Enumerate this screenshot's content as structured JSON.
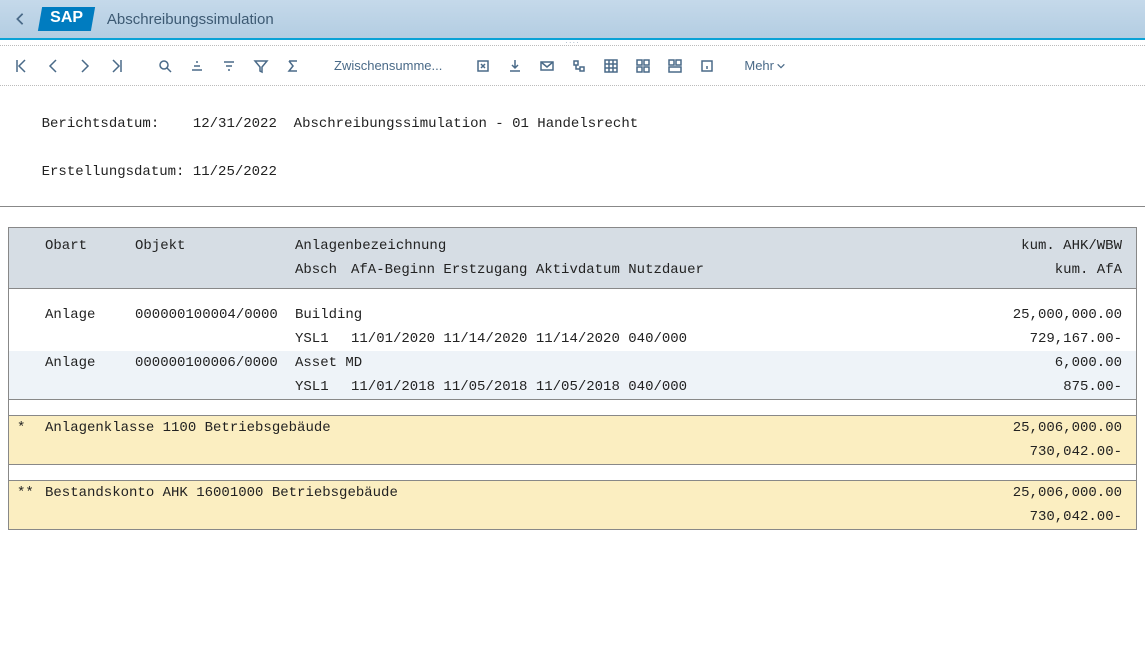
{
  "titlebar": {
    "title": "Abschreibungssimulation",
    "logo": "SAP"
  },
  "toolbar": {
    "subtotal_label": "Zwischensumme...",
    "more_label": "Mehr"
  },
  "report_header": {
    "line1_label": "Berichtsdatum:",
    "line1_date": "12/31/2022",
    "line1_text": "Abschreibungssimulation - 01 Handelsrecht",
    "line2_label": "Erstellungsdatum:",
    "line2_date": "11/25/2022"
  },
  "columns": {
    "obart": "Obart",
    "objekt": "Objekt",
    "desc": "Anlagenbezeichnung",
    "val1": "kum. AHK/WBW",
    "sub_absch": "Absch",
    "sub_afabeg": "AfA-Beginn",
    "sub_erst": "Erstzugang",
    "sub_aktiv": "Aktivdatum",
    "sub_nutz": "Nutzdauer",
    "val2": "kum. AfA"
  },
  "rows": [
    {
      "obart": "Anlage",
      "objekt": "000000100004/0000",
      "desc": "Building",
      "val1": "25,000,000.00",
      "absch": "YSL1",
      "afabeg": "11/01/2020",
      "erst": "11/14/2020",
      "aktiv": "11/14/2020",
      "nutz": "040/000",
      "val2": "729,167.00-"
    },
    {
      "obart": "Anlage",
      "objekt": "000000100006/0000",
      "desc": "Asset MD",
      "val1": "6,000.00",
      "absch": "YSL1",
      "afabeg": "11/01/2018",
      "erst": "11/05/2018",
      "aktiv": "11/05/2018",
      "nutz": "040/000",
      "val2": "875.00-"
    }
  ],
  "summary1": {
    "marker": "*",
    "text": "Anlagenklasse 1100 Betriebsgebäude",
    "val1": "25,006,000.00",
    "val2": "730,042.00-"
  },
  "summary2": {
    "marker": "**",
    "text": "Bestandskonto AHK 16001000 Betriebsgebäude",
    "val1": "25,006,000.00",
    "val2": "730,042.00-"
  }
}
